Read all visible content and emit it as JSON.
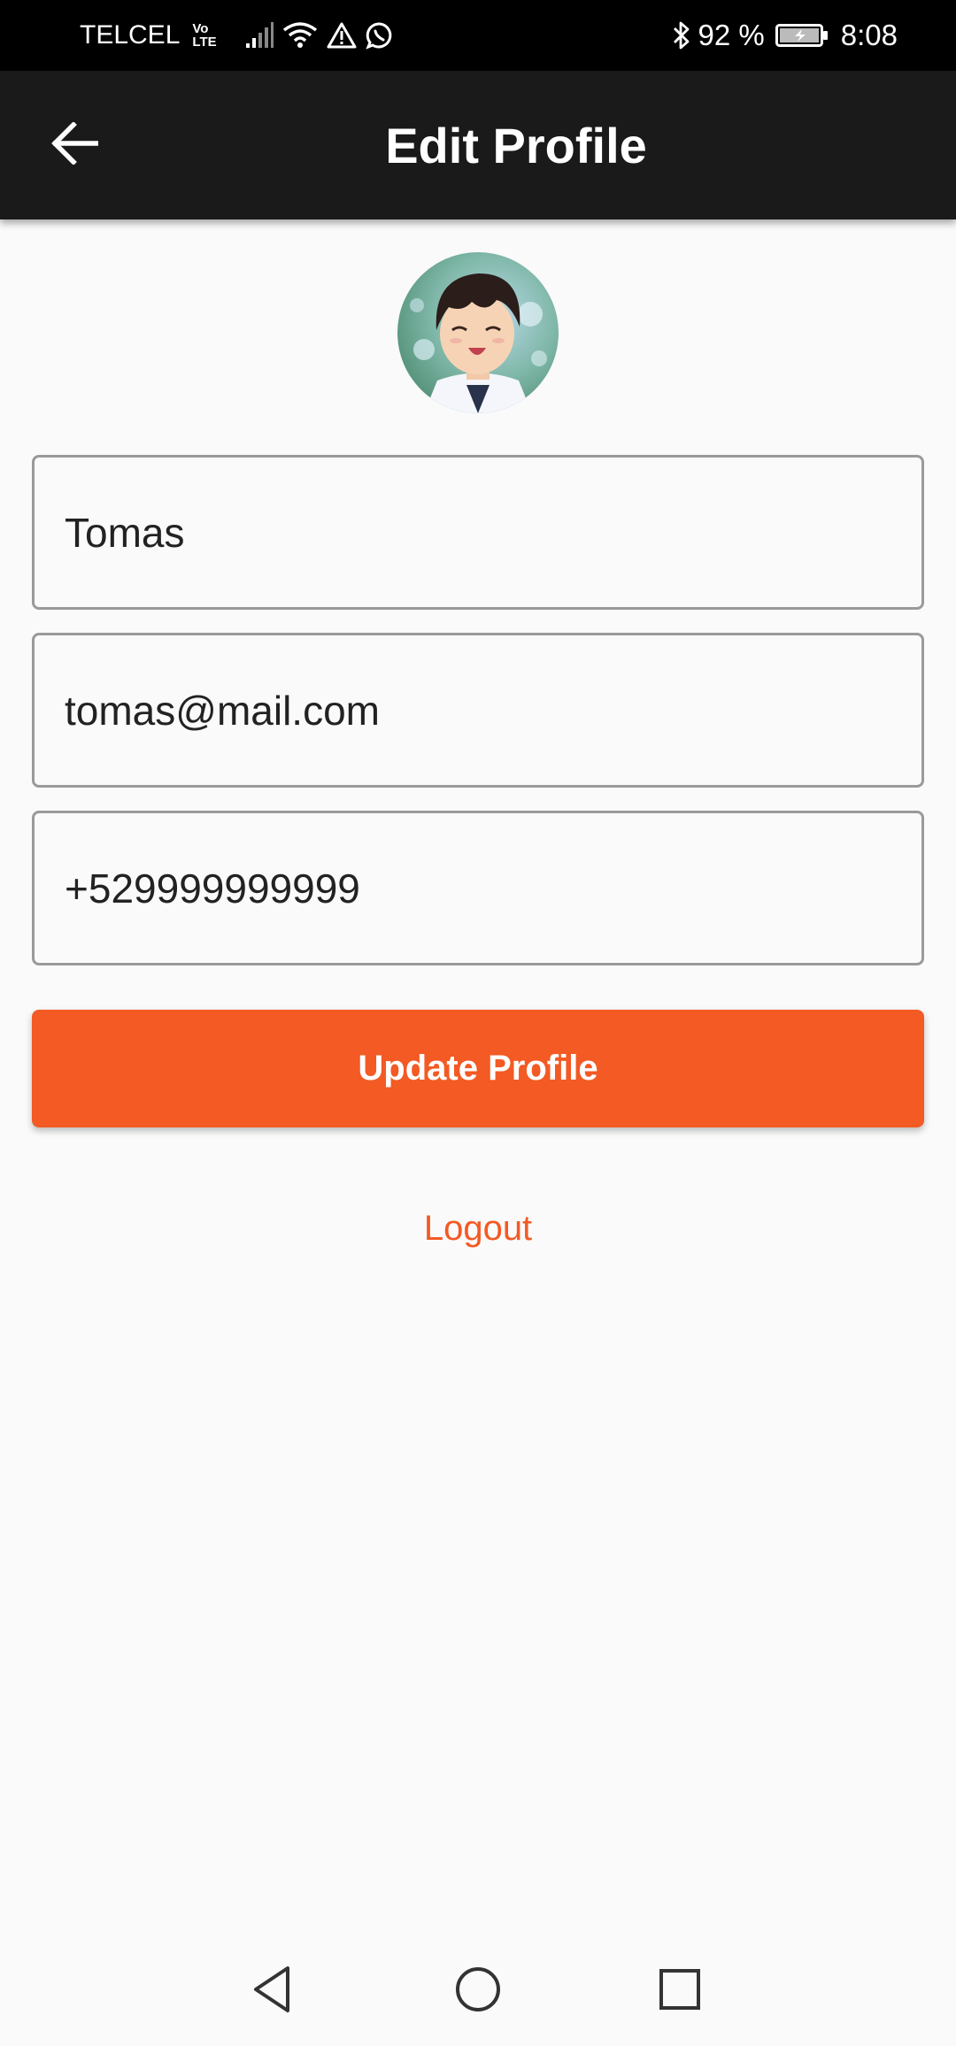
{
  "status_bar": {
    "carrier": "TELCEL",
    "volte_top": "Vo",
    "volte_bottom": "LTE",
    "battery_percent": "92 %",
    "time": "8:08",
    "icons": [
      "signal-icon",
      "wifi-icon",
      "warning-icon",
      "whatsapp-icon",
      "bluetooth-icon",
      "battery-charging-icon"
    ]
  },
  "app_bar": {
    "title": "Edit Profile",
    "back_icon": "arrow-back-icon"
  },
  "profile": {
    "avatar": "profile-avatar-image",
    "name_value": "Tomas",
    "email_value": "tomas@mail.com",
    "phone_value": "+529999999999"
  },
  "actions": {
    "update_label": "Update Profile",
    "logout_label": "Logout"
  },
  "colors": {
    "accent": "#f35a24",
    "app_bar": "#1a1a1a",
    "status_bar": "#000000",
    "background": "#fafafa",
    "field_border": "#9a9a9a"
  },
  "nav_bar": {
    "icons": [
      "nav-back-icon",
      "nav-home-icon",
      "nav-recents-icon"
    ]
  }
}
